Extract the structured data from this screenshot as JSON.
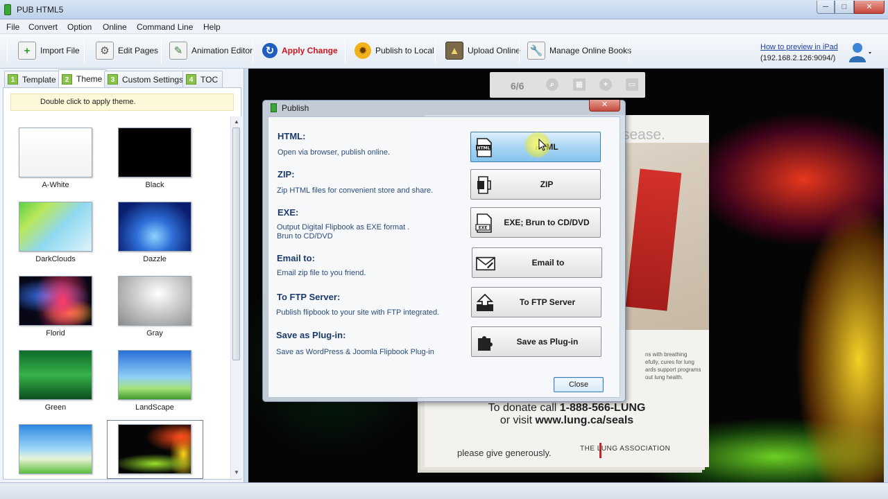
{
  "window": {
    "title": "PUB HTML5",
    "min": "─",
    "max": "□",
    "close": "✕"
  },
  "menu": [
    "File",
    "Convert",
    "Option",
    "Online",
    "Command Line",
    "Help"
  ],
  "toolbar": {
    "import_file": "Import File",
    "edit_pages": "Edit Pages",
    "animation_editor": "Animation Editor",
    "apply_change": "Apply Change",
    "publish_local": "Publish to Local",
    "upload_online": "Upload Online",
    "manage_books": "Manage Online Books",
    "howto_link": "How to preview in iPad",
    "ip_address": "(192.168.2.126:9094/)"
  },
  "tabs": [
    {
      "num": "1",
      "label": "Template"
    },
    {
      "num": "2",
      "label": "Theme"
    },
    {
      "num": "3",
      "label": "Custom Settings"
    },
    {
      "num": "4",
      "label": "TOC"
    }
  ],
  "theme_hint": "Double click to apply theme.",
  "themes": [
    "A-White",
    "Black",
    "DarkClouds",
    "Dazzle",
    "Florid",
    "Gray",
    "Green",
    "LandScape",
    "",
    ""
  ],
  "preview": {
    "page_indicator": "6/6",
    "headline": "Help us stamp out lung disease.",
    "small_text": "ns with breathing\nefully, cures for lung\nards support programs\nout lung health.",
    "donate_line1": "To donate call ",
    "donate_phone": "1-888-566-LUNG",
    "donate_line2": "or visit ",
    "donate_url": "www.lung.ca/seals",
    "give": "please give generously.",
    "assoc": "THE   LUNG ASSOCIATION"
  },
  "publish_dialog": {
    "title": "Publish",
    "options": [
      {
        "title": "HTML:",
        "desc": "Open via browser, publish online.",
        "button": "HTML"
      },
      {
        "title": "ZIP:",
        "desc": "Zip HTML files for convenient store and share.",
        "button": "ZIP"
      },
      {
        "title": "EXE:",
        "desc": "Output Digital Flipbook as EXE format .\nBrun to CD/DVD",
        "button": "EXE; Brun to CD/DVD"
      },
      {
        "title": "Email to:",
        "desc": "Email zip file to you friend.",
        "button": "Email to"
      },
      {
        "title": "To FTP Server:",
        "desc": "Publish flipbook to your site with FTP integrated.",
        "button": "To FTP Server"
      },
      {
        "title": "Save as Plug-in:",
        "desc": "Save as WordPress & Joomla Flipbook Plug-in",
        "button": "Save as Plug-in"
      }
    ],
    "close": "Close"
  }
}
